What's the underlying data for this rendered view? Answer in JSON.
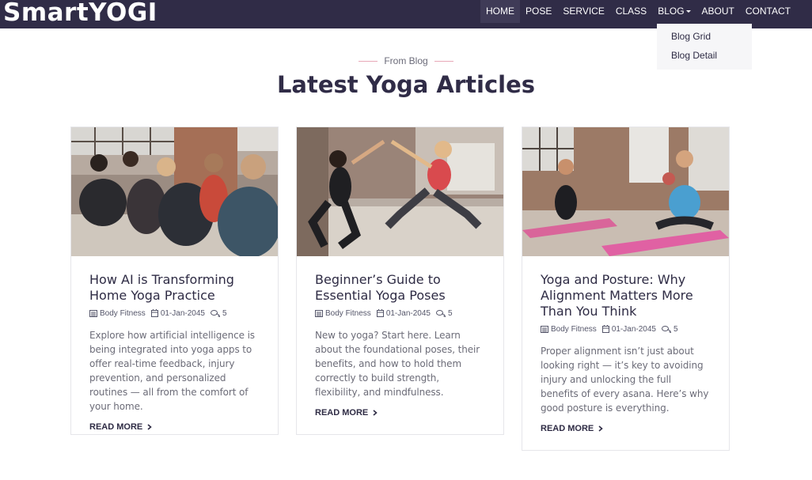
{
  "brand": "SmartYOGI",
  "nav": {
    "items": [
      {
        "label": "HOME"
      },
      {
        "label": "POSE"
      },
      {
        "label": "SERVICE"
      },
      {
        "label": "CLASS"
      },
      {
        "label": "BLOG"
      },
      {
        "label": "ABOUT"
      },
      {
        "label": "CONTACT"
      }
    ],
    "active": "HOME",
    "dropdown": [
      "Blog Grid",
      "Blog Detail"
    ]
  },
  "section": {
    "eyebrow": "From Blog",
    "title": "Latest Yoga Articles"
  },
  "cards": [
    {
      "title": "How AI is Transforming Home Yoga Practice",
      "category": "Body Fitness",
      "date": "01-Jan-2045",
      "comments": "5",
      "excerpt": "Explore how artificial intelligence is being integrated into yoga apps to offer real-time feedback, injury prevention, and personalized routines — all from the comfort of your home.",
      "cta": "READ MORE"
    },
    {
      "title": "Beginner’s Guide to Essential Yoga Poses",
      "category": "Body Fitness",
      "date": "01-Jan-2045",
      "comments": "5",
      "excerpt": "New to yoga? Start here. Learn about the foundational poses, their benefits, and how to hold them correctly to build strength, flexibility, and mindfulness.",
      "cta": "READ MORE"
    },
    {
      "title": "Yoga and Posture: Why Alignment Matters More Than You Think",
      "category": "Body Fitness",
      "date": "01-Jan-2045",
      "comments": "5",
      "excerpt": "Proper alignment isn’t just about looking right — it’s key to avoiding injury and unlocking the full benefits of every asana. Here’s why good posture is everything.",
      "cta": "READ MORE"
    }
  ],
  "colors": {
    "navbar": "#302c47",
    "nav_active": "#3f3b57",
    "heading": "#302c47",
    "accent_line": "#e8a8b8",
    "text_muted": "#6c6c78"
  },
  "icons": {
    "category": "list-icon",
    "date": "calendar-icon",
    "comments": "comments-icon",
    "cta": "chevron-right-icon"
  }
}
